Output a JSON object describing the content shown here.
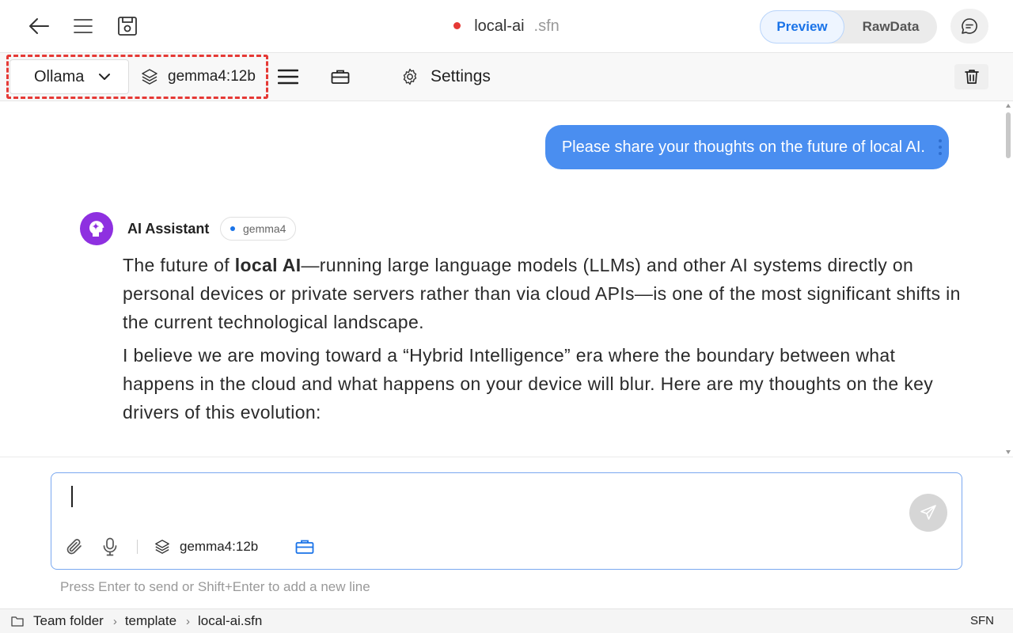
{
  "titlebar": {
    "file_name": "local-ai",
    "file_ext": ".sfn",
    "tabs": [
      {
        "label": "Preview",
        "active": true
      },
      {
        "label": "RawData",
        "active": false
      }
    ]
  },
  "toolbar": {
    "provider": "Ollama",
    "model": "gemma4:12b",
    "settings_label": "Settings"
  },
  "conversation": {
    "user_message": "Please share your thoughts on the future of local AI.",
    "assistant_name": "AI Assistant",
    "assistant_model_badge": "gemma4",
    "response": {
      "p1_pre": "The future of ",
      "p1_bold": "local AI",
      "p1_post": "—running large language models (LLMs) and other AI systems directly on personal devices or private servers rather than via cloud APIs—is one of the most significant shifts in the current technological landscape.",
      "p2": "I believe we are moving toward a “Hybrid Intelligence” era where the boundary between what happens in the cloud and what happens on your device will blur. Here are my thoughts on the key drivers of this evolution:"
    }
  },
  "composer": {
    "input_value": "",
    "model": "gemma4:12b",
    "hint": "Press Enter to send or Shift+Enter to add a new line"
  },
  "statusbar": {
    "breadcrumb": [
      "Team folder",
      "template",
      "local-ai.sfn"
    ],
    "right_label": "SFN"
  },
  "colors": {
    "accent": "#1a73e8",
    "user_bubble": "#4a8ef0",
    "avatar": "#8e30e0",
    "unsaved_dot": "#e53935",
    "highlight": "#e53935"
  }
}
